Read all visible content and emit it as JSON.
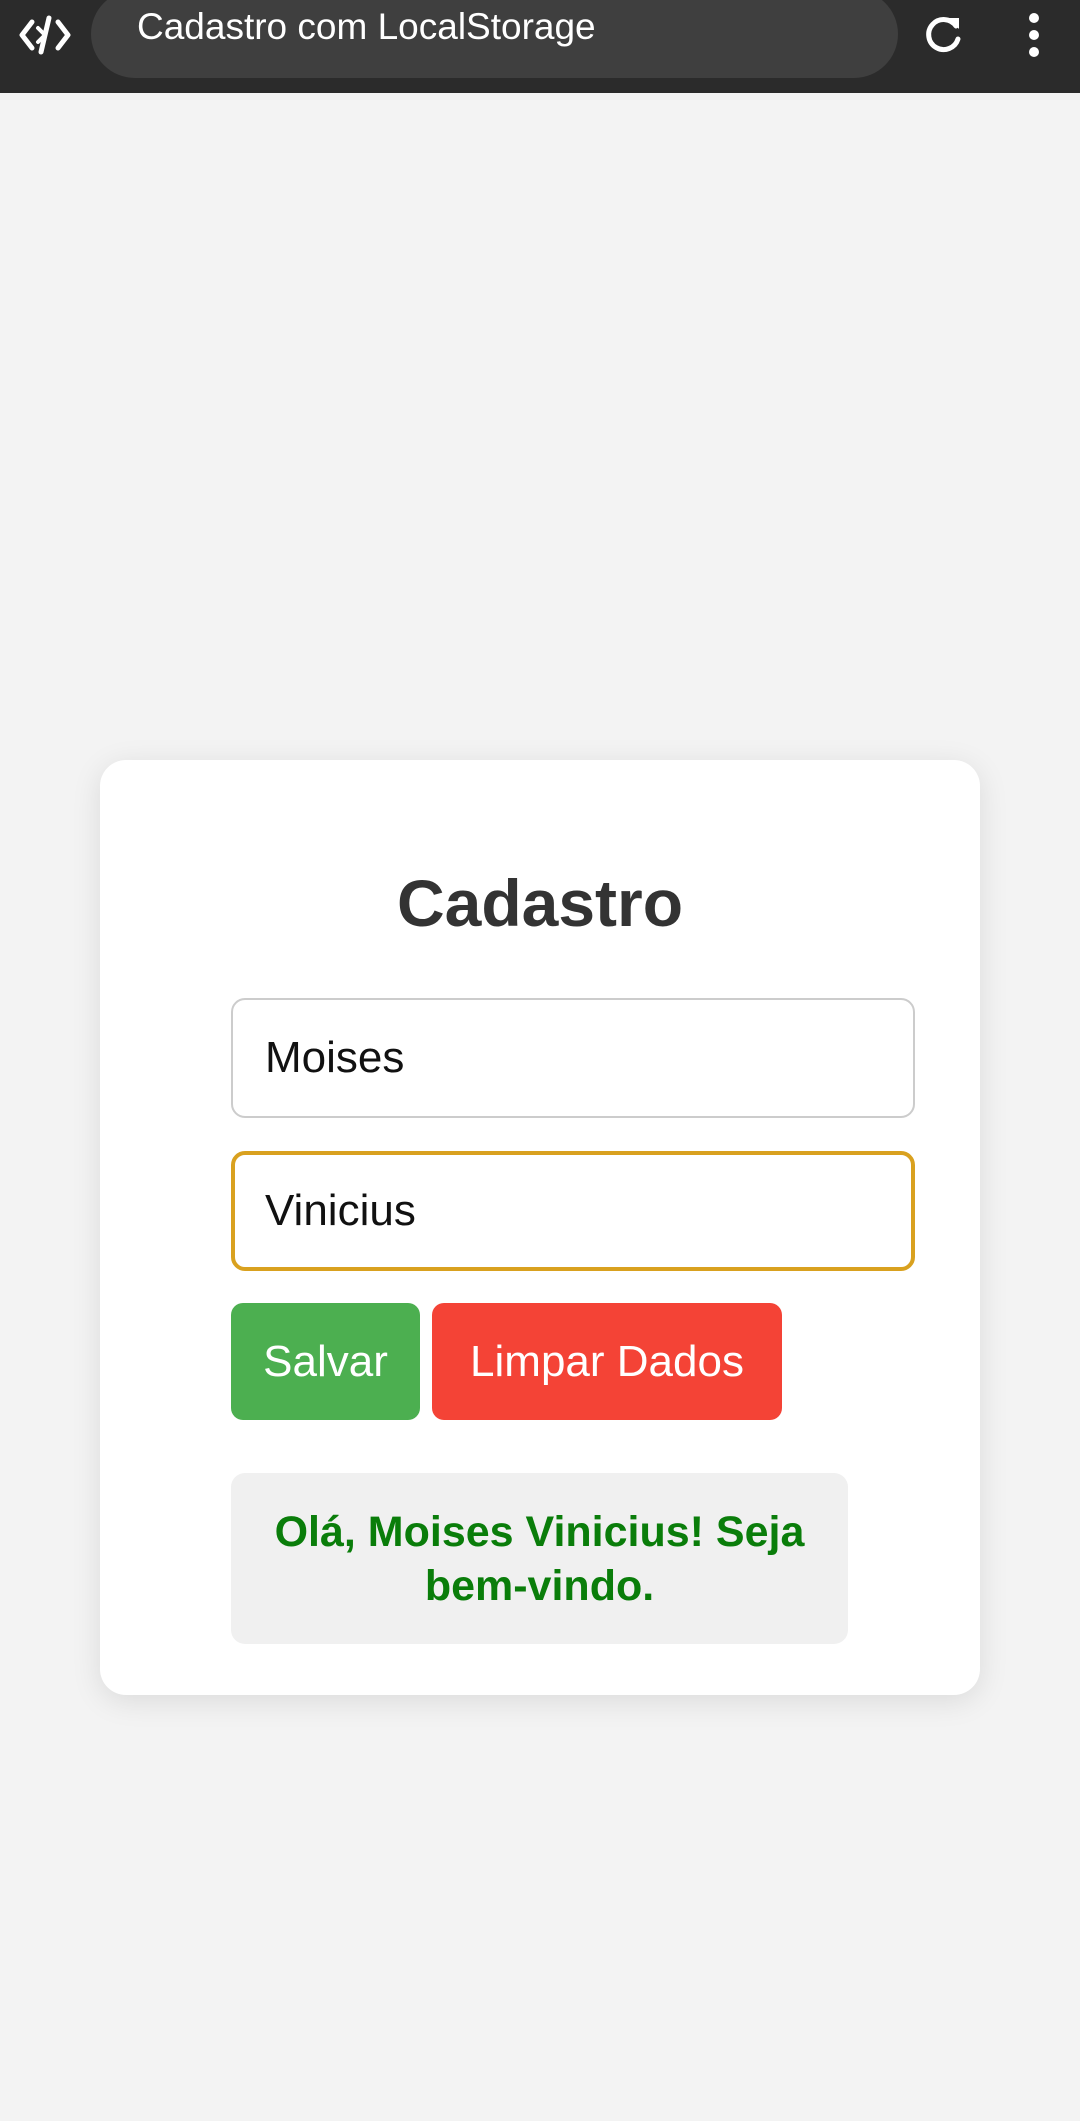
{
  "browser": {
    "page_title": "Cadastro com LocalStorage",
    "icons": {
      "app": "code-brackets-icon",
      "reload": "reload-icon",
      "menu": "more-vert-icon"
    }
  },
  "form": {
    "title": "Cadastro",
    "first_name_value": "Moises",
    "last_name_value": "Vinicius",
    "save_label": "Salvar",
    "clear_label": "Limpar Dados",
    "greeting": "Olá, Moises Vinicius! Seja bem-vindo."
  },
  "colors": {
    "background": "#f3f3f3",
    "topbar": "#2b2b2b",
    "save_button": "#4caf50",
    "clear_button": "#f44336",
    "focus_border": "#d9a11f",
    "greeting_text": "#0a7d0a"
  }
}
